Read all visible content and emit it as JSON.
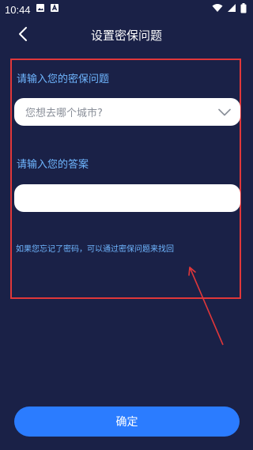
{
  "status_bar": {
    "time": "10:44"
  },
  "header": {
    "title": "设置密保问题"
  },
  "form": {
    "question_label": "请输入您的密保问题",
    "question_selected": "您想去哪个城市?",
    "answer_label": "请输入您的答案",
    "answer_value": "",
    "answer_placeholder": "",
    "hint": "如果您忘记了密码，可以通过密保问题来找回"
  },
  "footer": {
    "confirm_label": "确定"
  },
  "colors": {
    "background": "#1a2147",
    "accent": "#2b7cff",
    "label": "#6fb6ff",
    "annotation": "#e0373a"
  }
}
